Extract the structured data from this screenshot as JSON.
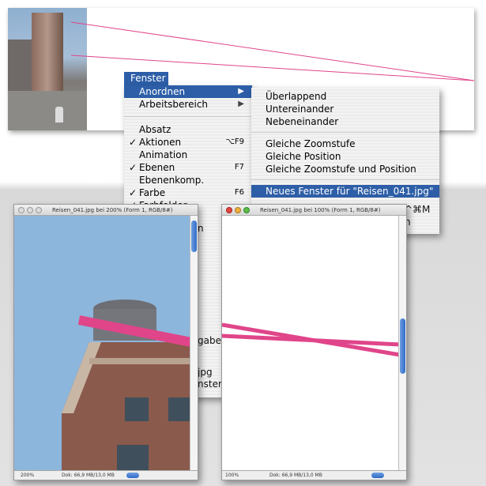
{
  "menu": {
    "title": "Fenster",
    "items": [
      {
        "label": "Anordnen",
        "submenu": true,
        "selected": true
      },
      {
        "label": "Arbeitsbereich",
        "submenu": true
      },
      {
        "label": "Absatz"
      },
      {
        "label": "Aktionen",
        "checked": true,
        "shortcut": "⌥F9"
      },
      {
        "label": "Animation"
      },
      {
        "label": "Ebenen",
        "checked": true,
        "shortcut": "F7"
      },
      {
        "label": "Ebenenkomp."
      },
      {
        "label": "Farbe",
        "checked": true,
        "shortcut": "F6"
      },
      {
        "label": "Farbfelder",
        "checked": true
      }
    ],
    "check": "✓",
    "arrow": "▶"
  },
  "submenu": {
    "items": [
      "Überlappend",
      "Untereinander",
      "Nebeneinander",
      "Gleiche Zoomstufe",
      "Gleiche Position",
      "Gleiche Zoomstufe und Position",
      "Neues Fenster für \"Reisen_041.jpg\""
    ]
  },
  "behind": {
    "shortcut_partial": "^⌘M",
    "n1": "n",
    "n2": "n",
    "gaber": "gaber",
    "jpg": "jpg",
    "nster": "nster.j"
  },
  "window_left": {
    "title": "Reisen_041.jpg bei 200% (Form 1, RGB/8#)",
    "zoom": "200%",
    "doc": "Dok: 66,9 MB/13,0 MB"
  },
  "window_right": {
    "title": "Reisen_041.jpg bei 100% (Form 1, RGB/8#)",
    "zoom": "100%",
    "doc": "Dok: 66,9 MB/13,0 MB"
  },
  "colors": {
    "accent": "#2d5ea7",
    "guide": "#e0458a"
  }
}
